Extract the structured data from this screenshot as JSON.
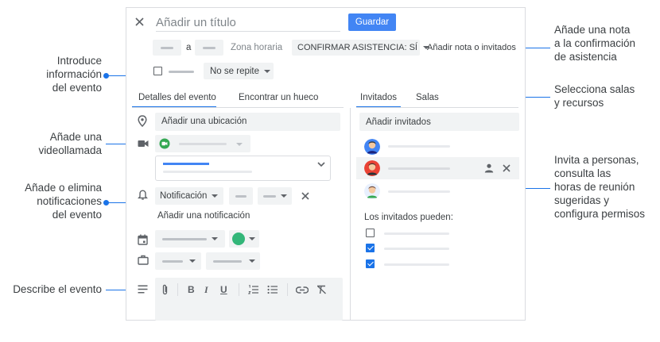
{
  "annotations": {
    "left": [
      {
        "lines": [
          "Introduce",
          "información",
          "del evento"
        ]
      },
      {
        "lines": [
          "Añade una",
          "videollamada"
        ]
      },
      {
        "lines": [
          "Añade o elimina",
          "notificaciones",
          "del evento"
        ]
      },
      {
        "lines": [
          "Describe el evento"
        ]
      }
    ],
    "right": [
      {
        "lines": [
          "Añade una nota",
          "a la confirmación",
          "de asistencia"
        ]
      },
      {
        "lines": [
          "Selecciona salas",
          "y recursos"
        ]
      },
      {
        "lines": [
          "Invita a personas,",
          "consulta las",
          "horas de reunión",
          "sugeridas y",
          "configura permisos"
        ]
      }
    ]
  },
  "header": {
    "title_placeholder": "Añadir un título",
    "save_label": "Guardar",
    "date_separator": "a",
    "timezone_label": "Zona horaria",
    "rsvp_label": "CONFIRMAR ASISTENCIA: SÍ",
    "rsvp_note_label": "Añadir nota o invitados",
    "repeat_label": "No se repite"
  },
  "tabs": {
    "left": [
      {
        "label": "Detalles del evento",
        "active": true
      },
      {
        "label": "Encontrar un hueco",
        "active": false
      }
    ],
    "right": [
      {
        "label": "Invitados",
        "active": true
      },
      {
        "label": "Salas",
        "active": false
      }
    ]
  },
  "details": {
    "location_placeholder": "Añadir una ubicación",
    "notification_type": "Notificación",
    "add_notification": "Añadir una notificación"
  },
  "guests": {
    "add_placeholder": "Añadir invitados",
    "permissions_title": "Los invitados pueden:",
    "permissions": [
      false,
      true,
      true
    ]
  },
  "colors": {
    "accent": "#1a73e8",
    "event_color": "#33b679"
  }
}
